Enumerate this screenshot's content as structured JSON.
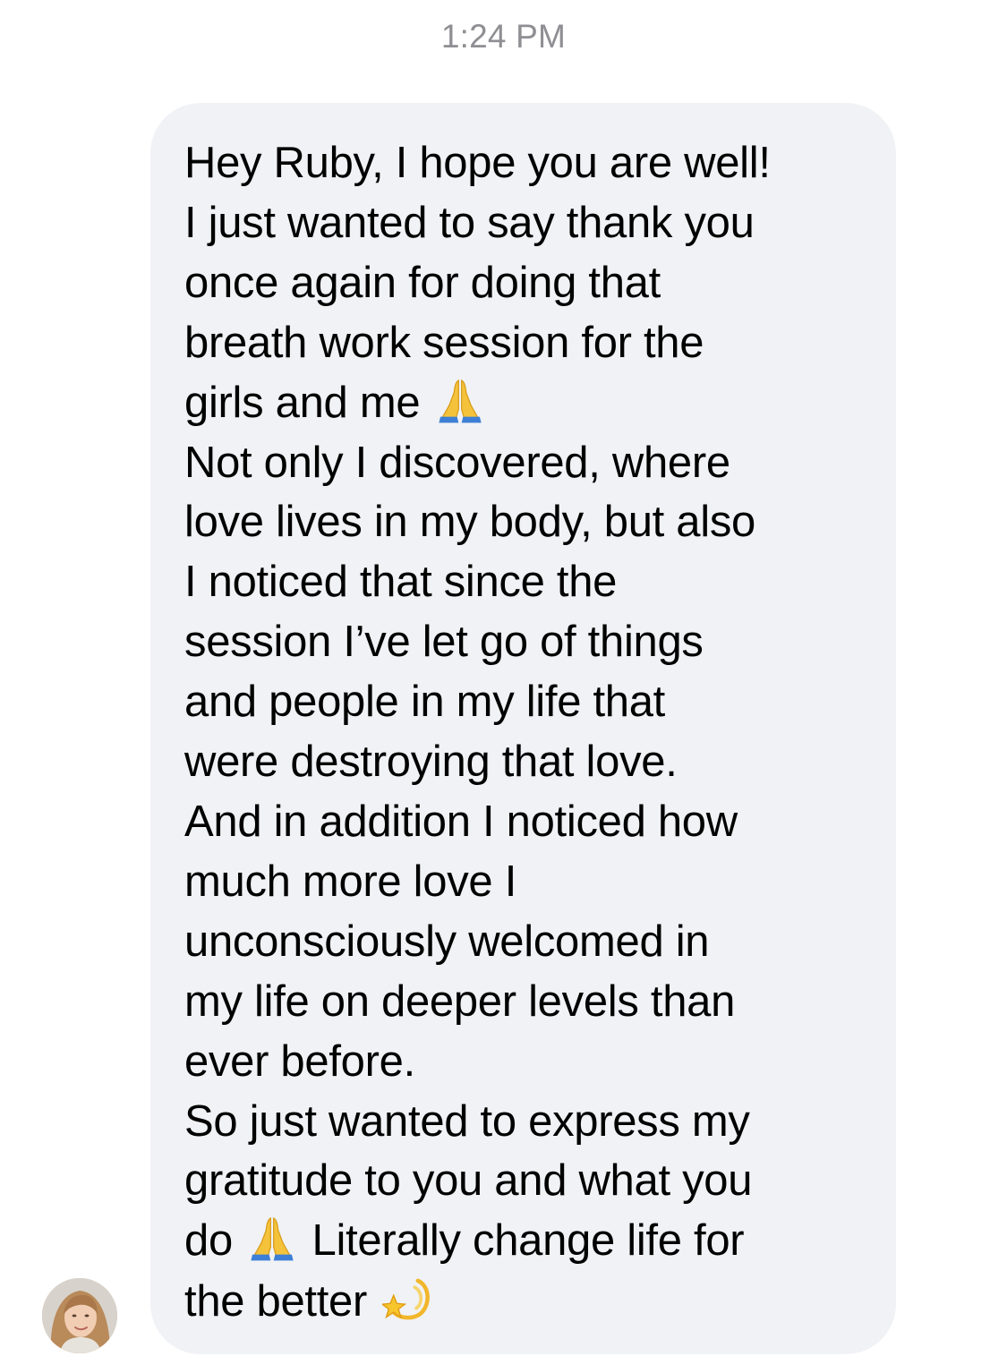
{
  "chat": {
    "timestamp": "1:24 PM",
    "message": {
      "lines": [
        {
          "text": "Hey Ruby, I hope you are well!"
        },
        {
          "text": "I just wanted to say thank you"
        },
        {
          "text": "once again for doing that"
        },
        {
          "text": "breath work session for the"
        },
        {
          "text": "girls and me ",
          "emoji": "folded-hands-icon"
        },
        {
          "text": "Not only I discovered, where"
        },
        {
          "text": "love lives in my body, but also"
        },
        {
          "text": "I noticed that since the"
        },
        {
          "text": "session I’ve let go of things"
        },
        {
          "text": "and people in my life that"
        },
        {
          "text": "were destroying that love."
        },
        {
          "text": "And in addition I noticed how"
        },
        {
          "text": "much more love I"
        },
        {
          "text": "unconsciously welcomed in"
        },
        {
          "text": "my life on deeper levels than"
        },
        {
          "text": "ever before."
        },
        {
          "text": "So just wanted to express my"
        },
        {
          "text": "gratitude to you and what you"
        },
        {
          "text": "do ",
          "emoji": "folded-hands-icon",
          "after": " Literally change life for"
        },
        {
          "text": "the better ",
          "emoji": "dizzy-star-icon"
        }
      ]
    },
    "sender": {
      "avatar_icon": "avatar-photo"
    }
  }
}
